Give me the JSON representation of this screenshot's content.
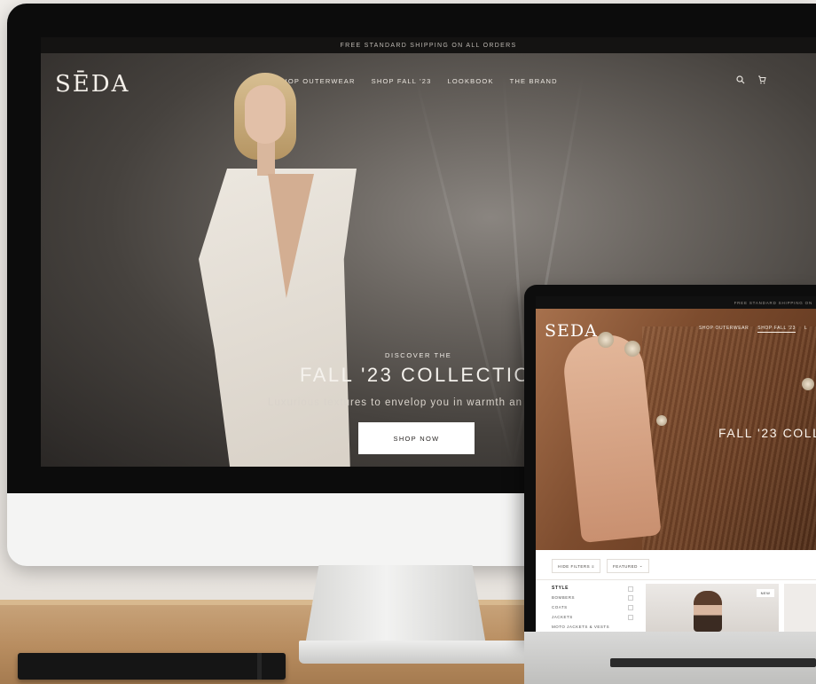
{
  "desktop": {
    "announcement": "FREE STANDARD SHIPPING ON ALL ORDERS",
    "logo": "SĒDA",
    "nav": [
      "SHOP OUTERWEAR",
      "SHOP FALL '23",
      "LOOKBOOK",
      "THE BRAND"
    ],
    "icons": [
      "search-icon",
      "cart-icon"
    ],
    "hero": {
      "eyebrow": "DISCOVER THE",
      "title": "FALL '23 COLLECTION",
      "subtitle": "Luxurious textures to envelop you in warmth an",
      "cta": "SHOP NOW"
    }
  },
  "laptop": {
    "announcement": "FREE STANDARD SHIPPING ON",
    "logo": "SEDA",
    "nav": [
      "SHOP OUTERWEAR",
      "SHOP FALL '23",
      "L"
    ],
    "hero_title": "FALL '23 COLL",
    "filters": [
      "HIDE FILTERS",
      "FEATURED"
    ],
    "filter_group": "STYLE",
    "filter_options": [
      "BOMBERS",
      "COATS",
      "JACKETS",
      "MOTO JACKETS & VESTS"
    ],
    "product_badge": "NEW"
  },
  "colors": {
    "background_text": "#f5f2ed",
    "announcement_bar": "#141312",
    "button_bg": "#ffffff"
  }
}
